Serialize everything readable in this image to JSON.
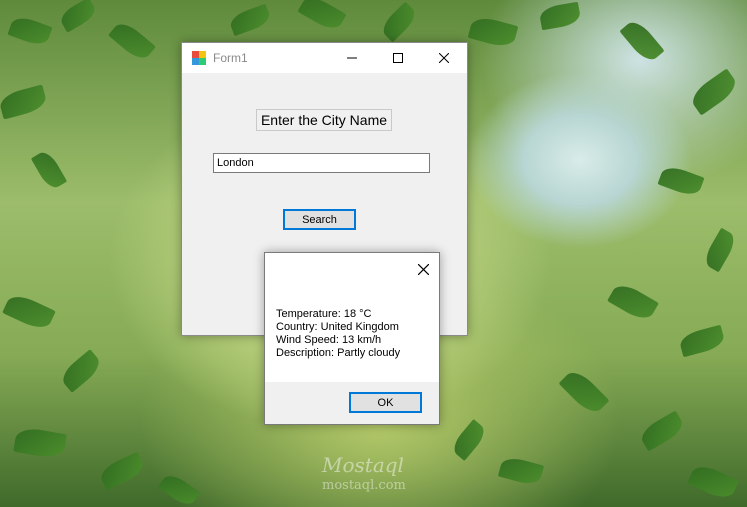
{
  "window": {
    "title": "Form1",
    "label": "Enter the City Name",
    "city_input_value": "London",
    "search_label": "Search"
  },
  "message_box": {
    "lines": [
      "Temperature: 18 °C",
      "Country: United Kingdom",
      "Wind Speed: 13 km/h",
      "Description: Partly cloudy"
    ],
    "ok_label": "OK"
  },
  "watermark": {
    "script_text": "Mostaql",
    "sub_text": "mostaql.com"
  },
  "icons": {
    "app": "winforms-app-icon",
    "minimize": "minimize-icon",
    "maximize": "maximize-icon",
    "close": "close-icon"
  },
  "colors": {
    "accent": "#0078d7",
    "window_bg": "#f0f0f0",
    "titlebar_bg": "#ffffff"
  }
}
